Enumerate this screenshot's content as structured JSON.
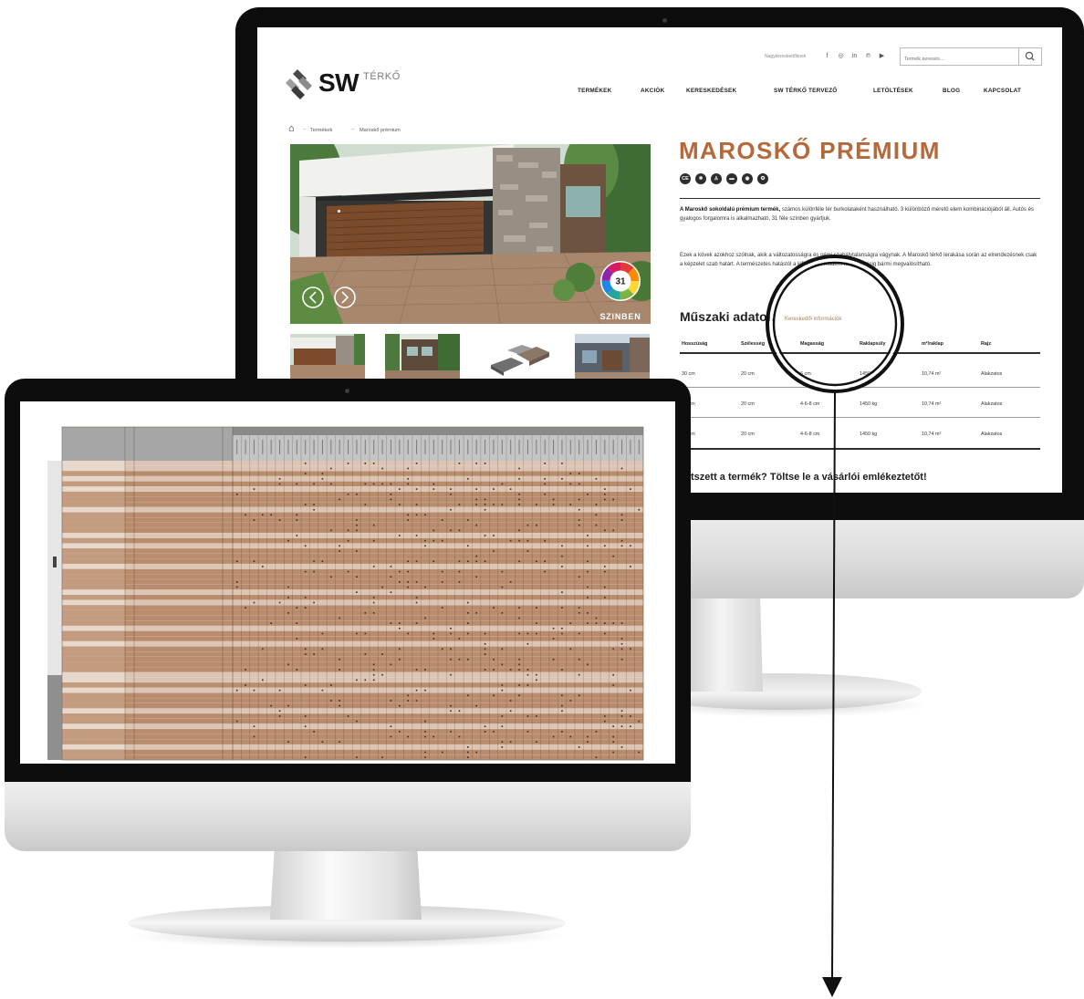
{
  "colors": {
    "accent": "#b5683a",
    "sheet_brown": "#b98c6d",
    "sheet_light": "#dcc5b4",
    "sheet_header": "#c4c4c4"
  },
  "back_screen": {
    "topbar": {
      "dealers_link": "Nagykereskedőknek",
      "social": [
        {
          "icon": "facebook-icon",
          "glyph": "f"
        },
        {
          "icon": "instagram-icon",
          "glyph": "◎"
        },
        {
          "icon": "linkedin-icon",
          "glyph": "in"
        },
        {
          "icon": "pinterest-icon",
          "glyph": "℗"
        },
        {
          "icon": "youtube-icon",
          "glyph": "▶"
        }
      ],
      "search_placeholder": "Termék keresés...",
      "search_icon": "search-icon"
    },
    "logo": {
      "brand": "SW",
      "name": "TÉRKŐ"
    },
    "nav": [
      "TERMÉKEK",
      "AKCIÓK",
      "KERESKEDÉSEK",
      "SW TÉRKŐ TERVEZŐ",
      "LETÖLTÉSEK",
      "BLOG",
      "KAPCSOLAT"
    ],
    "breadcrumb": {
      "home_icon": "home-icon",
      "separator": "–",
      "items": [
        "Termékek",
        "Maroskő prémium"
      ]
    },
    "gallery": {
      "badge_count": "31",
      "badge_label": "SZINBEN",
      "prev_icon": "arrow-left-icon",
      "next_icon": "arrow-right-icon",
      "thumbnails": 4
    },
    "product": {
      "title": "MAROSKŐ PRÉMIUM",
      "cert_icons": [
        {
          "icon": "ce-mark-icon",
          "glyph": "CE"
        },
        {
          "icon": "frost-resistant-icon",
          "glyph": "❄"
        },
        {
          "icon": "pedestrian-icon",
          "glyph": "♙"
        },
        {
          "icon": "car-icon",
          "glyph": "▬"
        },
        {
          "icon": "tire-icon",
          "glyph": "◉"
        },
        {
          "icon": "quality-icon",
          "glyph": "✪"
        }
      ],
      "para1_lead": "A Maroskő sokoldalú prémium termék,",
      "para1_rest": " számos különféle tér burkolataként használható. 3 különböző méretű elem kombinációjából áll. Autós és gyalogos forgalomra is alkalmazható, 31 féle színben gyártjuk.",
      "para2": "Ezek a kövek azokhoz szólnak, akik a változatosságra és némi szabálytalanságra vágynak. A Maroskő térkő lerakása során az elrendezésnek csak a képzelet szab határt. A természetes hatástól a kifinomult, modern megjelenésig bármi megvalósítható."
    },
    "tabs": [
      "Műszaki adatok",
      "Kereskedői információk"
    ],
    "table": {
      "headers": [
        "Hosszúság",
        "Szélesség",
        "Magasság",
        "Raklapsúly",
        "m²/raklap",
        "Rajz"
      ],
      "rows": [
        [
          "30 cm",
          "20 cm",
          "6 cm",
          "1450 kg",
          "10,74 m²",
          "Alakzatos"
        ],
        [
          "30 cm",
          "20 cm",
          "4-6-8 cm",
          "1450 kg",
          "10,74 m²",
          "Alakzatos"
        ],
        [
          "30 cm",
          "20 cm",
          "4-6-8 cm",
          "1450 kg",
          "10,74 m²",
          "Alakzatos"
        ]
      ]
    },
    "cta": "Tetszett a termék? Töltse le a vásárlói emlékeztetőt!"
  },
  "front_screen": {
    "content": "price-list-spreadsheet"
  }
}
